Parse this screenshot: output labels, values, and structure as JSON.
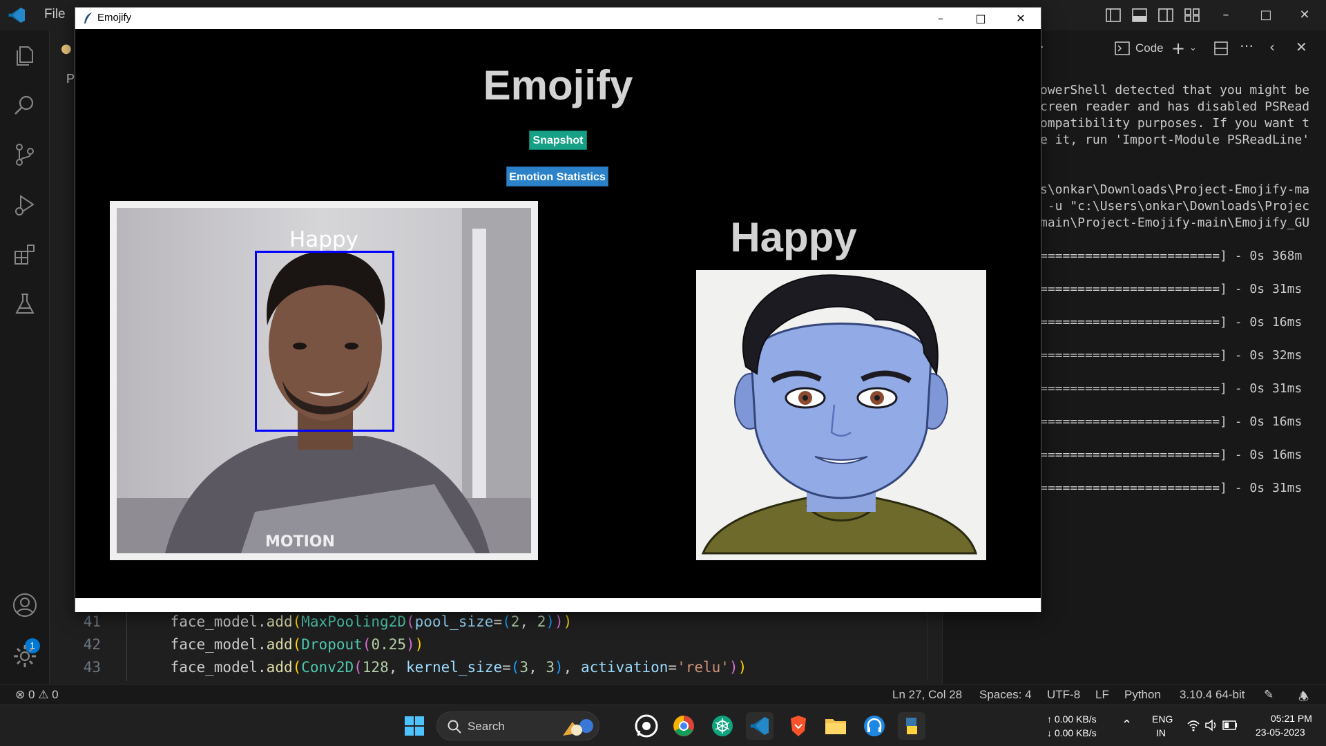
{
  "vscode": {
    "menu_file": "File",
    "tab_partial": "P",
    "code_lines": [
      {
        "num": "41",
        "parts": [
          [
            "c-id",
            "face_model"
          ],
          [
            "c-id",
            "."
          ],
          [
            "c-fn",
            "add"
          ],
          [
            "c-p1",
            "("
          ],
          [
            "c-cls",
            "MaxPooling2D"
          ],
          [
            "c-p2",
            "("
          ],
          [
            "c-par",
            "pool_size"
          ],
          [
            "c-id",
            "="
          ],
          [
            "c-p3",
            "("
          ],
          [
            "c-num",
            "2"
          ],
          [
            "c-id",
            ", "
          ],
          [
            "c-num",
            "2"
          ],
          [
            "c-p3",
            ")"
          ],
          [
            "c-p2",
            ")"
          ],
          [
            "c-p1",
            ")"
          ]
        ]
      },
      {
        "num": "42",
        "parts": [
          [
            "c-id",
            "face_model"
          ],
          [
            "c-id",
            "."
          ],
          [
            "c-fn",
            "add"
          ],
          [
            "c-p1",
            "("
          ],
          [
            "c-cls",
            "Dropout"
          ],
          [
            "c-p2",
            "("
          ],
          [
            "c-num",
            "0.25"
          ],
          [
            "c-p2",
            ")"
          ],
          [
            "c-p1",
            ")"
          ]
        ]
      },
      {
        "num": "43",
        "parts": [
          [
            "c-id",
            "face_model"
          ],
          [
            "c-id",
            "."
          ],
          [
            "c-fn",
            "add"
          ],
          [
            "c-p1",
            "("
          ],
          [
            "c-cls",
            "Conv2D"
          ],
          [
            "c-p2",
            "("
          ],
          [
            "c-num",
            "128"
          ],
          [
            "c-id",
            ", "
          ],
          [
            "c-par",
            "kernel_size"
          ],
          [
            "c-id",
            "="
          ],
          [
            "c-p3",
            "("
          ],
          [
            "c-num",
            "3"
          ],
          [
            "c-id",
            ", "
          ],
          [
            "c-num",
            "3"
          ],
          [
            "c-p3",
            ")"
          ],
          [
            "c-id",
            ", "
          ],
          [
            "c-par",
            "activation"
          ],
          [
            "c-id",
            "="
          ],
          [
            "c-str",
            "'relu'"
          ],
          [
            "c-p2",
            ")"
          ],
          [
            "c-p1",
            ")"
          ]
        ]
      }
    ],
    "account_badge": "1"
  },
  "terminal": {
    "toolbar_label": "Code",
    "lines": [
      "owerShell detected that you might be",
      "creen reader and has disabled PSRead",
      "ompatibility purposes. If you want t",
      "e it, run 'Import-Module PSReadLine'",
      "",
      "",
      "s\\onkar\\Downloads\\Project-Emojify-ma",
      " -u \"c:\\Users\\onkar\\Downloads\\Projec",
      "main\\Project-Emojify-main\\Emojify_GU",
      "",
      "========================] - 0s 368m",
      "",
      "========================] - 0s 31ms",
      "",
      "========================] - 0s 16ms",
      "",
      "========================] - 0s 32ms",
      "",
      "========================] - 0s 31ms",
      "",
      "========================] - 0s 16ms",
      "",
      "========================] - 0s 16ms",
      "",
      "========================] - 0s 31ms"
    ]
  },
  "status_bar": {
    "errors": "0",
    "warnings": "0",
    "position": "Ln 27, Col 28",
    "spaces": "Spaces: 4",
    "encoding": "UTF-8",
    "eol": "LF",
    "language": "Python",
    "interpreter": "3.10.4 64-bit"
  },
  "taskbar": {
    "search_label": "Search",
    "net_up": "↑ 0.00 KB/s",
    "net_down": "↓ 0.00 KB/s",
    "lang_top": "ENG",
    "lang_bottom": "IN",
    "time": "05:21 PM",
    "date": "23-05-2023"
  },
  "emojify": {
    "window_title": "Emojify",
    "heading": "Emojify",
    "snapshot_label": "Snapshot",
    "stats_label": "Emotion Statistics",
    "face_label": "Happy",
    "emotion_result": "Happy"
  },
  "colors": {
    "snapshot_bg": "#16a085",
    "stats_bg": "#2c82c9",
    "face_box": "#0000ff",
    "heading": "#d3d3d3"
  }
}
